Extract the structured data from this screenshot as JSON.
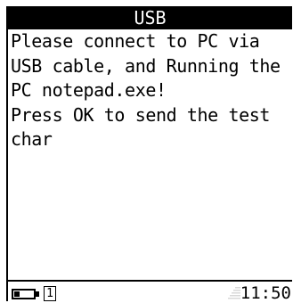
{
  "title_bar": {
    "title": "USB"
  },
  "message": {
    "lines": [
      "Please connect to PC via",
      "USB cable, and Running the",
      "PC notepad.exe!",
      "Press OK to send the test",
      "char"
    ]
  },
  "status_bar": {
    "battery_icon": "battery-low-icon",
    "line_indicator": "1",
    "signal_icon": "signal-strength-icon",
    "time": "11:50"
  }
}
